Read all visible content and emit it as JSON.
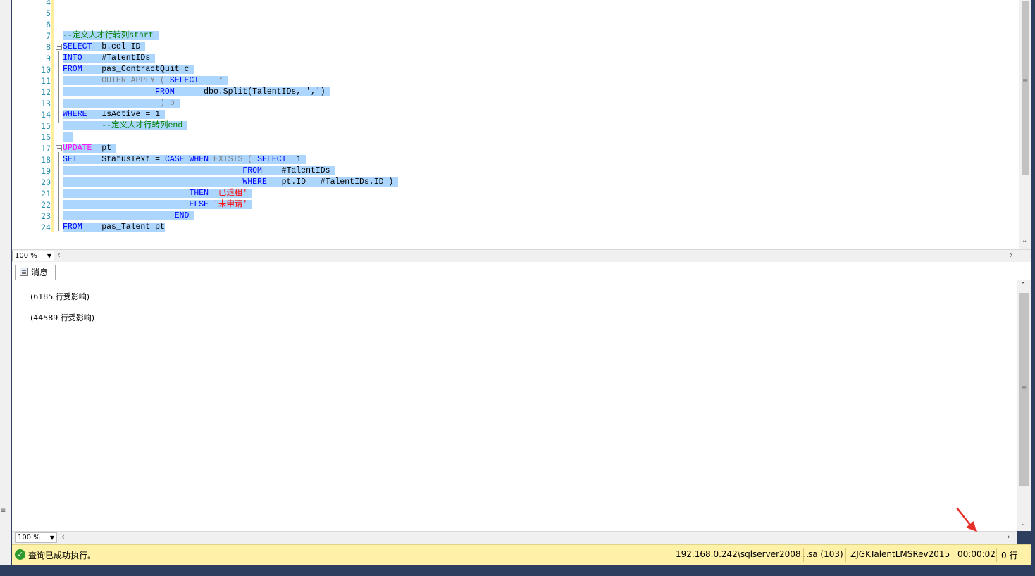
{
  "editor": {
    "line_numbers": [
      "4",
      "5",
      "6",
      "7",
      "8",
      "9",
      "10",
      "11",
      "12",
      "13",
      "14",
      "15",
      "16",
      "17",
      "18",
      "19",
      "20",
      "21",
      "22",
      "23",
      "24"
    ],
    "zoom": "100 %"
  },
  "code": {
    "l7": "--定义人才行转列start",
    "l8_kw": "SELECT",
    "l8_rest": "  b.col ID",
    "l9_kw": "INTO",
    "l9_rest": "    #TalentIDs",
    "l10_kw": "FROM",
    "l10_rest": "    pas_ContractQuit c",
    "l11_a": "        OUTER APPLY ( ",
    "l11_kw": "SELECT",
    "l11_rest": "    *",
    "l12_kw": "FROM",
    "l12_rest": "      dbo.Split(TalentIDs, ',')",
    "l13": "                    ) b",
    "l14_kw": "WHERE",
    "l14_rest": "   IsActive = 1",
    "l15": "--定义人才行转列end",
    "l17_kw": "UPDATE",
    "l17_rest": "  pt",
    "l18_kw": "SET",
    "l18_a": "     StatusText = ",
    "l18_case": "CASE",
    "l18_when": "WHEN",
    "l18_exists": "EXISTS",
    "l18_paren": " ( ",
    "l18_select": "SELECT",
    "l18_one": "  1",
    "l19_kw": "FROM",
    "l19_rest": "    #TalentIDs",
    "l20_kw": "WHERE",
    "l20_rest": "   pt.ID = #TalentIDs.ID )",
    "l21_kw": "THEN",
    "l21_str": "'已退租'",
    "l22_kw": "ELSE",
    "l22_str": "'未申请'",
    "l23_kw": "END",
    "l24_kw": "FROM",
    "l24_rest": "    pas_Talent pt"
  },
  "results": {
    "tab_label": "消息",
    "messages": [
      "(6185 行受影响)",
      "(44589 行受影响)"
    ],
    "zoom": "100 %"
  },
  "status_bar": {
    "text": "查询已成功执行。",
    "server": "192.168.0.242\\sqlserver2008...",
    "user": "sa (103)",
    "database": "ZJGKTalentLMSRev2015",
    "elapsed": "00:00:02",
    "rows": "0 行"
  },
  "colors": {
    "selection": "#add6ff",
    "keyword": "#0000ff",
    "comment": "#008000",
    "string": "#ff0000",
    "status_bg": "#fff2a8",
    "annotation_arrow": "#e8302a"
  }
}
